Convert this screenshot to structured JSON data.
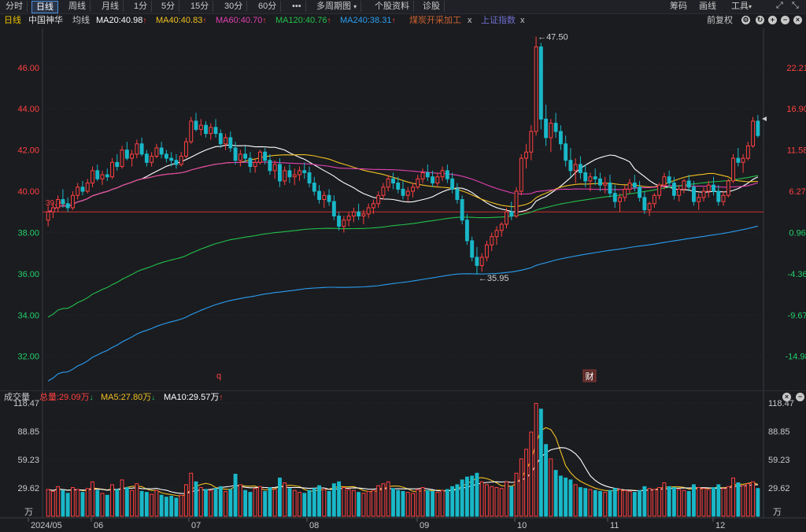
{
  "toolbar": {
    "left_items": [
      "分时",
      "日线",
      "周线",
      "月线",
      "1分",
      "5分",
      "15分",
      "30分",
      "60分",
      "•••",
      "多周期图",
      "个股资料",
      "诊股"
    ],
    "active_index": 1,
    "right_items": [
      "筹码",
      "画线",
      "工具"
    ]
  },
  "indicators": {
    "period": "日线",
    "stock": "中国神华",
    "ma_label": "均线",
    "ma20": "MA20:40.98",
    "ma40": "MA40:40.83",
    "ma60": "MA60:40.70",
    "ma120": "MA120:40.76",
    "ma240": "MA240:38.31",
    "sector": "煤炭开采加工",
    "index": "上证指数",
    "close_x": "x",
    "adjust": "前复权"
  },
  "colors": {
    "up": "#ff4040",
    "down": "#19b8c8",
    "ma20": "#ffffff",
    "ma40": "#f0c020",
    "ma60": "#e040b0",
    "ma120": "#22c04a",
    "ma240": "#2a9ef0",
    "ref": "#c83030"
  },
  "price_axis": {
    "left_ticks": [
      "46.00",
      "44.00",
      "42.00",
      "40.00",
      "38.00",
      "36.00",
      "34.00",
      "32.00"
    ],
    "right_ticks": [
      "22.21%",
      "16.90%",
      "11.58%",
      "6.27%",
      "0.96%",
      "-4.36%",
      "-9.67%",
      "-14.98%"
    ],
    "ref_value": "39.00"
  },
  "annotations": {
    "high": "47.50",
    "low": "35.95",
    "marker_q": "q",
    "marker_cai": "财"
  },
  "volume": {
    "title": "成交量",
    "total": "总量:29.09万",
    "ma5": "MA5:27.80万",
    "ma10": "MA10:29.57万",
    "ticks": [
      "118.47",
      "88.85",
      "59.23",
      "29.62"
    ],
    "unit": "万"
  },
  "date_axis": [
    "2024/05",
    "06",
    "07",
    "08",
    "09",
    "10",
    "11",
    "12"
  ],
  "chart_data": {
    "type": "candlestick",
    "price_range": [
      30.5,
      47.9
    ],
    "volume_range": [
      0,
      118.47
    ],
    "ma_values": {
      "MA20": 40.98,
      "MA40": 40.83,
      "MA60": 40.7,
      "MA120": 40.76,
      "MA240": 38.31
    },
    "high": 47.5,
    "low": 35.95,
    "ohlcv": [
      [
        38.6,
        39.3,
        38.3,
        39.0,
        28
      ],
      [
        39.0,
        39.4,
        38.7,
        39.2,
        26
      ],
      [
        39.2,
        39.8,
        39.0,
        39.6,
        31
      ],
      [
        39.6,
        40.1,
        39.2,
        39.4,
        27
      ],
      [
        39.4,
        39.7,
        39.0,
        39.2,
        24
      ],
      [
        39.2,
        40.0,
        39.1,
        39.8,
        30
      ],
      [
        39.8,
        40.4,
        39.6,
        40.2,
        28
      ],
      [
        40.2,
        40.5,
        39.8,
        40.0,
        25
      ],
      [
        40.0,
        40.6,
        39.9,
        40.4,
        29
      ],
      [
        40.4,
        41.2,
        40.2,
        41.0,
        36
      ],
      [
        41.0,
        41.3,
        40.5,
        40.6,
        27
      ],
      [
        40.6,
        41.0,
        40.3,
        40.8,
        24
      ],
      [
        40.8,
        41.1,
        40.5,
        40.7,
        22
      ],
      [
        40.7,
        41.6,
        40.6,
        41.4,
        33
      ],
      [
        41.4,
        41.8,
        41.0,
        41.2,
        28
      ],
      [
        41.2,
        42.2,
        41.1,
        42.0,
        38
      ],
      [
        42.0,
        42.4,
        41.5,
        41.6,
        30
      ],
      [
        41.6,
        42.0,
        41.2,
        41.8,
        27
      ],
      [
        41.8,
        42.5,
        41.6,
        42.3,
        34
      ],
      [
        42.3,
        42.6,
        41.7,
        41.8,
        26
      ],
      [
        41.8,
        42.0,
        41.2,
        41.4,
        25
      ],
      [
        41.4,
        41.9,
        41.2,
        41.7,
        23
      ],
      [
        41.7,
        42.3,
        41.6,
        42.1,
        27
      ],
      [
        42.1,
        42.4,
        41.6,
        41.8,
        22
      ],
      [
        41.8,
        42.0,
        41.4,
        41.6,
        20
      ],
      [
        41.6,
        41.9,
        41.2,
        41.5,
        21
      ],
      [
        41.5,
        41.8,
        41.1,
        41.3,
        19
      ],
      [
        41.3,
        41.9,
        41.2,
        41.7,
        22
      ],
      [
        41.7,
        42.6,
        41.6,
        42.4,
        33
      ],
      [
        42.4,
        43.6,
        42.3,
        43.4,
        45
      ],
      [
        43.4,
        43.8,
        42.9,
        43.0,
        36
      ],
      [
        43.0,
        43.5,
        42.7,
        43.2,
        30
      ],
      [
        43.2,
        43.4,
        42.6,
        42.8,
        28
      ],
      [
        42.8,
        43.3,
        42.5,
        43.1,
        27
      ],
      [
        43.1,
        43.5,
        42.6,
        42.8,
        29
      ],
      [
        42.8,
        43.0,
        42.1,
        42.3,
        31
      ],
      [
        42.3,
        42.8,
        42.0,
        42.6,
        26
      ],
      [
        42.6,
        42.9,
        41.9,
        42.1,
        28
      ],
      [
        42.1,
        42.4,
        41.3,
        41.5,
        44
      ],
      [
        41.5,
        42.0,
        41.2,
        41.8,
        33
      ],
      [
        41.8,
        42.2,
        41.4,
        41.6,
        27
      ],
      [
        41.6,
        41.9,
        40.9,
        41.2,
        25
      ],
      [
        41.2,
        41.6,
        40.9,
        41.4,
        29
      ],
      [
        41.4,
        42.0,
        41.3,
        41.9,
        31
      ],
      [
        41.9,
        42.1,
        41.3,
        41.5,
        26
      ],
      [
        41.5,
        41.8,
        40.8,
        41.0,
        30
      ],
      [
        41.0,
        41.5,
        40.6,
        41.3,
        28
      ],
      [
        41.3,
        41.6,
        40.2,
        40.5,
        40
      ],
      [
        40.5,
        41.2,
        40.3,
        41.0,
        35
      ],
      [
        41.0,
        41.3,
        40.4,
        40.7,
        29
      ],
      [
        40.7,
        41.1,
        40.3,
        40.8,
        27
      ],
      [
        40.8,
        41.2,
        40.5,
        41.0,
        25
      ],
      [
        41.0,
        41.4,
        40.6,
        40.9,
        24
      ],
      [
        40.9,
        41.2,
        40.2,
        40.4,
        27
      ],
      [
        40.4,
        40.7,
        39.8,
        40.0,
        29
      ],
      [
        40.0,
        40.3,
        39.4,
        39.6,
        32
      ],
      [
        39.6,
        40.0,
        39.2,
        39.8,
        28
      ],
      [
        39.8,
        40.1,
        39.3,
        39.5,
        26
      ],
      [
        39.5,
        39.8,
        38.6,
        38.8,
        34
      ],
      [
        38.8,
        39.0,
        38.1,
        38.3,
        36
      ],
      [
        38.3,
        38.8,
        38.0,
        38.6,
        30
      ],
      [
        38.6,
        39.0,
        38.3,
        38.8,
        28
      ],
      [
        38.8,
        39.2,
        38.5,
        39.0,
        27
      ],
      [
        39.0,
        39.4,
        38.6,
        38.8,
        25
      ],
      [
        38.8,
        39.1,
        38.4,
        38.9,
        24
      ],
      [
        38.9,
        39.4,
        38.7,
        39.2,
        26
      ],
      [
        39.2,
        39.6,
        38.9,
        39.4,
        27
      ],
      [
        39.4,
        40.0,
        39.2,
        39.8,
        32
      ],
      [
        39.8,
        40.4,
        39.6,
        40.2,
        34
      ],
      [
        40.2,
        40.8,
        40.0,
        40.6,
        36
      ],
      [
        40.6,
        40.9,
        40.1,
        40.4,
        29
      ],
      [
        40.4,
        40.7,
        39.9,
        40.1,
        27
      ],
      [
        40.1,
        40.5,
        39.6,
        39.8,
        26
      ],
      [
        39.8,
        40.2,
        39.5,
        40.0,
        25
      ],
      [
        40.0,
        40.4,
        39.7,
        40.2,
        24
      ],
      [
        40.2,
        40.8,
        40.1,
        40.6,
        28
      ],
      [
        40.6,
        41.1,
        40.4,
        40.9,
        30
      ],
      [
        40.9,
        41.3,
        40.5,
        40.7,
        27
      ],
      [
        40.7,
        41.0,
        40.2,
        40.4,
        26
      ],
      [
        40.4,
        40.9,
        40.2,
        40.7,
        25
      ],
      [
        40.7,
        41.2,
        40.5,
        41.0,
        27
      ],
      [
        41.0,
        41.3,
        40.4,
        40.6,
        28
      ],
      [
        40.6,
        40.9,
        39.9,
        40.1,
        31
      ],
      [
        40.1,
        40.4,
        39.4,
        39.6,
        33
      ],
      [
        39.6,
        39.8,
        38.4,
        38.6,
        38
      ],
      [
        38.6,
        38.9,
        37.4,
        37.6,
        41
      ],
      [
        37.6,
        37.8,
        36.6,
        36.8,
        42
      ],
      [
        36.8,
        37.3,
        35.95,
        36.4,
        45
      ],
      [
        36.4,
        37.0,
        36.1,
        36.8,
        36
      ],
      [
        36.8,
        37.6,
        36.6,
        37.4,
        33
      ],
      [
        37.4,
        38.0,
        37.1,
        37.8,
        31
      ],
      [
        37.8,
        38.3,
        37.4,
        38.1,
        30
      ],
      [
        38.1,
        38.5,
        37.8,
        38.4,
        29
      ],
      [
        38.4,
        39.2,
        38.2,
        39.0,
        36
      ],
      [
        39.0,
        39.5,
        38.6,
        38.8,
        31
      ],
      [
        38.8,
        40.2,
        38.7,
        40.0,
        45
      ],
      [
        40.0,
        41.8,
        39.8,
        41.6,
        60
      ],
      [
        41.6,
        42.3,
        41.1,
        41.9,
        70
      ],
      [
        41.9,
        43.2,
        41.5,
        42.9,
        88
      ],
      [
        42.9,
        47.5,
        42.7,
        47.0,
        118
      ],
      [
        47.0,
        47.2,
        43.0,
        43.5,
        112
      ],
      [
        43.5,
        44.2,
        42.2,
        42.6,
        75
      ],
      [
        42.6,
        43.5,
        41.9,
        43.3,
        60
      ],
      [
        43.3,
        43.8,
        42.6,
        42.9,
        48
      ],
      [
        42.9,
        43.2,
        42.0,
        42.3,
        42
      ],
      [
        42.3,
        42.7,
        41.2,
        41.5,
        40
      ],
      [
        41.5,
        42.1,
        40.7,
        41.0,
        38
      ],
      [
        41.0,
        41.6,
        40.4,
        41.3,
        33
      ],
      [
        41.3,
        41.7,
        40.6,
        40.9,
        30
      ],
      [
        40.9,
        41.3,
        40.2,
        40.5,
        29
      ],
      [
        40.5,
        40.9,
        40.0,
        40.7,
        28
      ],
      [
        40.7,
        41.1,
        40.3,
        40.6,
        27
      ],
      [
        40.6,
        40.9,
        40.0,
        40.3,
        26
      ],
      [
        40.3,
        40.7,
        39.9,
        40.4,
        25
      ],
      [
        40.4,
        40.8,
        39.7,
        39.9,
        27
      ],
      [
        39.9,
        40.3,
        39.2,
        39.5,
        29
      ],
      [
        39.5,
        39.9,
        39.0,
        39.7,
        28
      ],
      [
        39.7,
        40.3,
        39.5,
        40.1,
        27
      ],
      [
        40.1,
        40.6,
        39.9,
        40.4,
        26
      ],
      [
        40.4,
        40.8,
        40.0,
        40.2,
        25
      ],
      [
        40.2,
        40.5,
        39.5,
        39.7,
        27
      ],
      [
        39.7,
        40.0,
        38.9,
        39.1,
        31
      ],
      [
        39.1,
        39.5,
        38.8,
        39.4,
        29
      ],
      [
        39.4,
        39.9,
        39.2,
        39.8,
        28
      ],
      [
        39.8,
        40.4,
        39.6,
        40.3,
        30
      ],
      [
        40.3,
        40.9,
        40.1,
        40.7,
        35
      ],
      [
        40.7,
        41.0,
        40.2,
        40.4,
        31
      ],
      [
        40.4,
        40.7,
        39.6,
        39.8,
        30
      ],
      [
        39.8,
        40.3,
        39.5,
        40.1,
        28
      ],
      [
        40.1,
        40.6,
        39.9,
        40.5,
        27
      ],
      [
        40.5,
        40.8,
        40.0,
        40.2,
        26
      ],
      [
        40.2,
        40.5,
        39.3,
        39.5,
        33
      ],
      [
        39.5,
        39.9,
        39.1,
        39.7,
        30
      ],
      [
        39.7,
        40.2,
        39.5,
        40.0,
        29
      ],
      [
        40.0,
        40.5,
        39.7,
        40.3,
        28
      ],
      [
        40.3,
        40.7,
        39.8,
        40.0,
        30
      ],
      [
        40.0,
        40.3,
        39.3,
        39.5,
        33
      ],
      [
        39.5,
        40.0,
        39.3,
        39.8,
        29
      ],
      [
        39.8,
        40.6,
        39.7,
        40.5,
        31
      ],
      [
        40.5,
        41.8,
        40.4,
        41.6,
        40
      ],
      [
        41.6,
        42.1,
        41.2,
        41.4,
        35
      ],
      [
        41.4,
        41.8,
        40.9,
        41.6,
        32
      ],
      [
        41.6,
        42.4,
        41.5,
        42.2,
        34
      ],
      [
        42.2,
        43.6,
        42.1,
        43.4,
        36
      ],
      [
        43.4,
        43.7,
        42.6,
        42.7,
        29
      ]
    ]
  }
}
